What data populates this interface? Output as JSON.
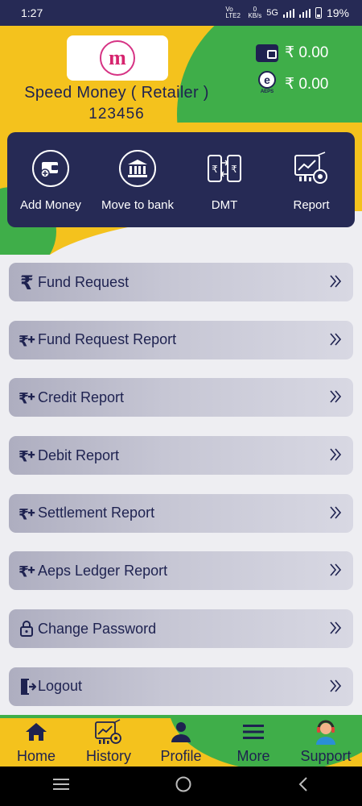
{
  "status_bar": {
    "time": "1:27",
    "volte": "Vo LTE2",
    "net_speed_value": "0",
    "net_speed_unit": "KB/s",
    "network": "5G",
    "battery": "19%"
  },
  "header": {
    "retailer_name": "Speed Money ( Retailer )",
    "retailer_id": "123456",
    "wallet_balance": "₹ 0.00",
    "aeps_balance": "₹ 0.00",
    "aeps_label": "AEPS"
  },
  "actions": [
    {
      "label": "Add Money"
    },
    {
      "label": "Move to bank"
    },
    {
      "label": "DMT"
    },
    {
      "label": "Report"
    }
  ],
  "menu": [
    {
      "label": "Fund Request",
      "icon": "rupee-icon"
    },
    {
      "label": "Fund Request Report",
      "icon": "rupee-plus-icon"
    },
    {
      "label": "Credit Report",
      "icon": "rupee-plus-icon"
    },
    {
      "label": "Debit Report",
      "icon": "rupee-plus-icon"
    },
    {
      "label": "Settlement Report",
      "icon": "rupee-plus-icon"
    },
    {
      "label": "Aeps Ledger Report",
      "icon": "rupee-plus-icon"
    },
    {
      "label": "Change Password",
      "icon": "lock-icon"
    },
    {
      "label": "Logout",
      "icon": "logout-icon"
    }
  ],
  "bottom_nav": [
    {
      "label": "Home",
      "icon": "home-icon"
    },
    {
      "label": "History",
      "icon": "history-icon"
    },
    {
      "label": "Profile",
      "icon": "profile-icon"
    },
    {
      "label": "More",
      "icon": "menu-icon"
    },
    {
      "label": "Support",
      "icon": "support-icon"
    }
  ],
  "colors": {
    "navy": "#262a55",
    "yellow": "#f4c21d",
    "green": "#3fae49",
    "menu_bg": "#c6c6d4"
  }
}
